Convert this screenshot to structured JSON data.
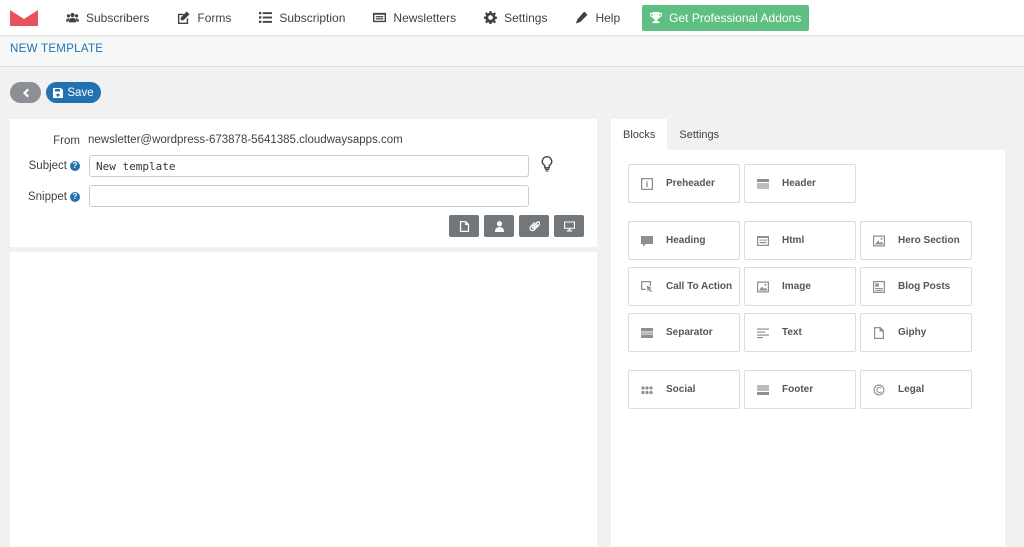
{
  "nav": {
    "items": [
      {
        "label": "Subscribers",
        "icon": "users-icon"
      },
      {
        "label": "Forms",
        "icon": "edit-icon"
      },
      {
        "label": "Subscription",
        "icon": "list-icon"
      },
      {
        "label": "Newsletters",
        "icon": "newsletter-icon"
      },
      {
        "label": "Settings",
        "icon": "gear-icon"
      },
      {
        "label": "Help",
        "icon": "pen-icon"
      }
    ],
    "pro_label": "Get Professional Addons"
  },
  "page": {
    "title": "NEW TEMPLATE"
  },
  "actions": {
    "save_label": "Save"
  },
  "form": {
    "from_label": "From",
    "from_value": "newsletter@wordpress-673878-5641385.cloudwaysapps.com",
    "subject_label": "Subject",
    "subject_value": "New template",
    "snippet_label": "Snippet",
    "snippet_value": "",
    "help_glyph": "?"
  },
  "tabs": [
    {
      "label": "Blocks",
      "active": true
    },
    {
      "label": "Settings",
      "active": false
    }
  ],
  "blocks": {
    "preheader": "Preheader",
    "header": "Header",
    "heading": "Heading",
    "html": "Html",
    "hero": "Hero Section",
    "cta": "Call To Action",
    "image": "Image",
    "blog": "Blog Posts",
    "separator": "Separator",
    "text": "Text",
    "giphy": "Giphy",
    "social": "Social",
    "footer": "Footer",
    "legal": "Legal"
  },
  "colors": {
    "brand_red": "#e8505b",
    "accent_blue": "#2271b1",
    "pro_green": "#5fbf83",
    "tool_grey": "#72777c"
  }
}
